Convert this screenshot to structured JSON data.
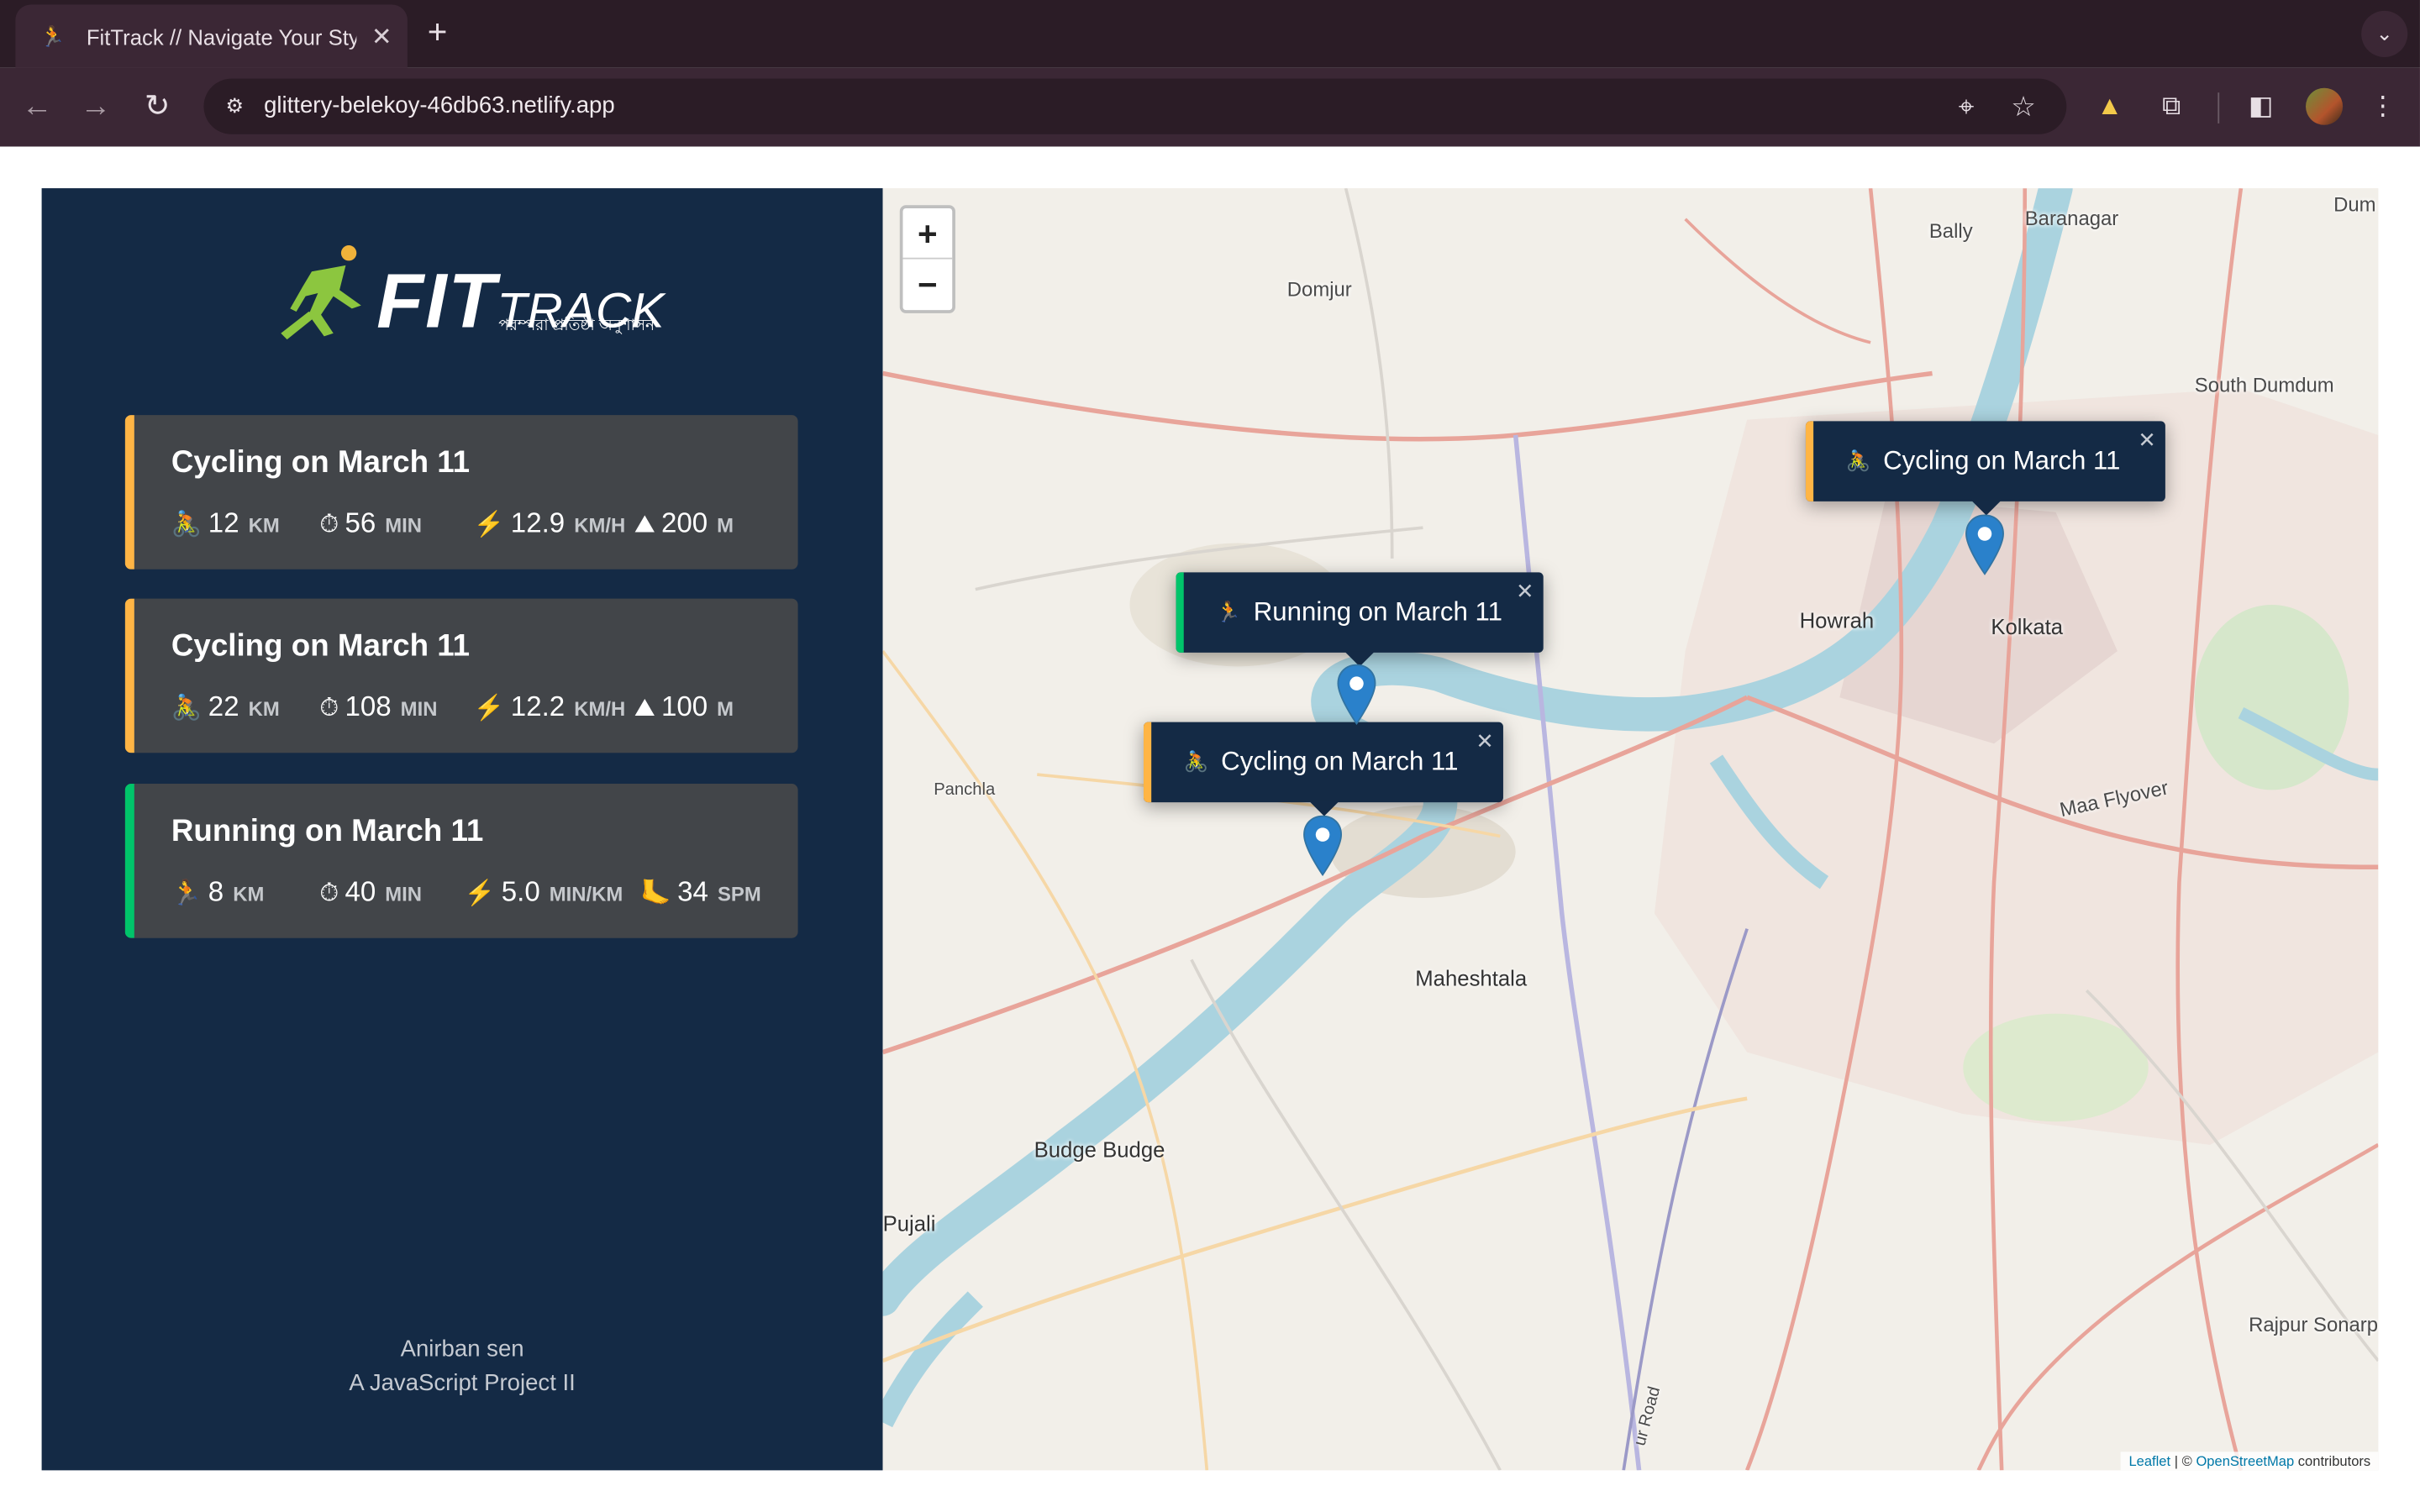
{
  "browser": {
    "tab_title": "FitTrack // Navigate Your Style",
    "tab_close": "✕",
    "new_tab": "+",
    "tab_menu": "⌄",
    "url": "glittery-belekoy-46db63.netlify.app"
  },
  "logo": {
    "fit": "FIT",
    "track": "TRACK",
    "subtitle": "পরম্পরা প্রতিষ্ঠা অনুশাসন"
  },
  "workouts": [
    {
      "type": "cycling",
      "title": "Cycling on March 11",
      "color": "#ffb545",
      "stats": [
        {
          "icon": "🚴",
          "value": "12",
          "unit": "KM"
        },
        {
          "icon": "⏱",
          "value": "56",
          "unit": "MIN"
        },
        {
          "icon": "⚡️",
          "value": "12.9",
          "unit": "KM/H"
        },
        {
          "icon": "⛰",
          "value": "200",
          "unit": "M"
        }
      ]
    },
    {
      "type": "cycling",
      "title": "Cycling on March 11",
      "color": "#ffb545",
      "stats": [
        {
          "icon": "🚴",
          "value": "22",
          "unit": "KM"
        },
        {
          "icon": "⏱",
          "value": "108",
          "unit": "MIN"
        },
        {
          "icon": "⚡️",
          "value": "12.2",
          "unit": "KM/H"
        },
        {
          "icon": "⛰",
          "value": "100",
          "unit": "M"
        }
      ]
    },
    {
      "type": "running",
      "title": "Running on March 11",
      "color": "#00c46a",
      "stats": [
        {
          "icon": "🏃",
          "value": "8",
          "unit": "KM"
        },
        {
          "icon": "⏱",
          "value": "40",
          "unit": "MIN"
        },
        {
          "icon": "⚡️",
          "value": "5.0",
          "unit": "MIN/KM"
        },
        {
          "icon": "🦶",
          "value": "34",
          "unit": "SPM"
        }
      ]
    }
  ],
  "footer": {
    "author": "Anirban sen",
    "project": "A JavaScript Project II"
  },
  "map": {
    "zoom_in": "+",
    "zoom_out": "−",
    "places": [
      "Bally",
      "Baranagar",
      "Dum",
      "Domjur",
      "South Dumdum",
      "Howrah",
      "Kolkata",
      "Panchla",
      "Maa Flyover",
      "Maheshtala",
      "Budge Budge",
      "Pujali",
      "Rajpur Sonarp",
      "ur Road"
    ],
    "popups": [
      {
        "icon": "🚴",
        "title": "Cycling on March 11",
        "color": "#ffb545",
        "close": "✕"
      },
      {
        "icon": "🏃",
        "title": "Running on March 11",
        "color": "#00c46a",
        "close": "✕"
      },
      {
        "icon": "🚴",
        "title": "Cycling on March 11",
        "color": "#ffb545",
        "close": "✕"
      }
    ],
    "attribution": {
      "leaflet": "Leaflet",
      "sep": "|",
      "copy": "©",
      "osm": "OpenStreetMap",
      "contributors": "contributors"
    }
  }
}
